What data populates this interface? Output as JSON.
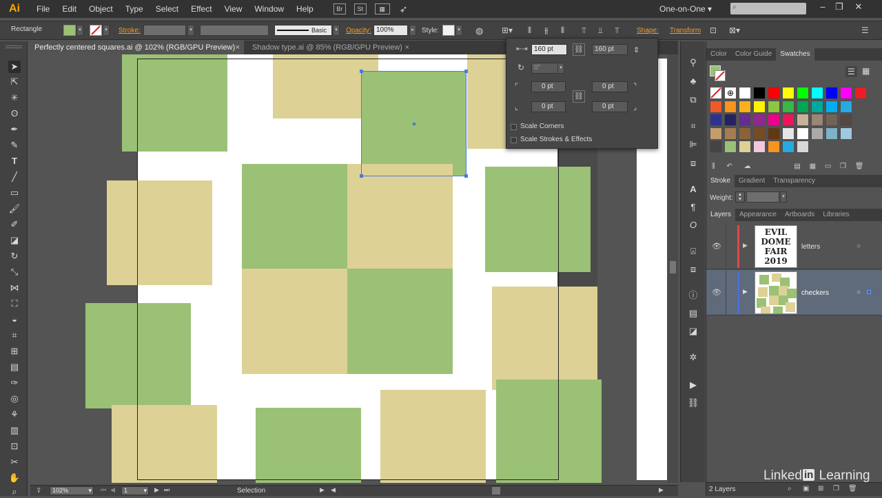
{
  "app": {
    "logo": "Ai",
    "workspace": "One-on-One"
  },
  "menu": [
    "File",
    "Edit",
    "Object",
    "Type",
    "Select",
    "Effect",
    "View",
    "Window",
    "Help"
  ],
  "bridge_buttons": [
    "Br",
    "St"
  ],
  "control": {
    "tool_name": "Rectangle",
    "stroke_label": "Stroke:",
    "stroke_style": "Basic",
    "opacity_label": "Opacity:",
    "opacity_value": "100%",
    "style_label": "Style:",
    "shape_label": "Shape:",
    "transform_label": "Transform"
  },
  "tabs": [
    {
      "label": "Perfectly centered squares.ai @ 102% (RGB/GPU Preview)",
      "close": "×"
    },
    {
      "label": "Shadow type.ai @ 85% (RGB/GPU Preview)",
      "close": "×"
    }
  ],
  "popup": {
    "width": "160 pt",
    "height": "160 pt",
    "angle": "0°",
    "corner_tl": "0 pt",
    "corner_tr": "0 pt",
    "corner_bl": "0 pt",
    "corner_br": "0 pt",
    "scale_corners": "Scale Corners",
    "scale_strokes": "Scale Strokes & Effects"
  },
  "panels": {
    "color_tabs": [
      "Color",
      "Color Guide",
      "Swatches"
    ],
    "stroke_tabs": [
      "Stroke",
      "Gradient",
      "Transparency"
    ],
    "weight_label": "Weight:",
    "layer_tabs": [
      "Layers",
      "Appearance",
      "Artboards",
      "Libraries"
    ],
    "layers": [
      {
        "name": "letters",
        "color": "#e04848",
        "thumb_lines": [
          "EVIL",
          "DOME",
          "FAIR",
          "2019"
        ]
      },
      {
        "name": "checkers",
        "color": "#4a6fd8"
      }
    ],
    "layer_count": "2 Layers"
  },
  "status": {
    "zoom": "102%",
    "artboard": "1",
    "tool": "Selection"
  },
  "watermark": {
    "prefix": "Linked",
    "in": "in",
    "suffix": "Learning"
  },
  "colors": {
    "green": "#9bc176",
    "tan": "#ddd196",
    "selection": "#4a7cd8"
  }
}
